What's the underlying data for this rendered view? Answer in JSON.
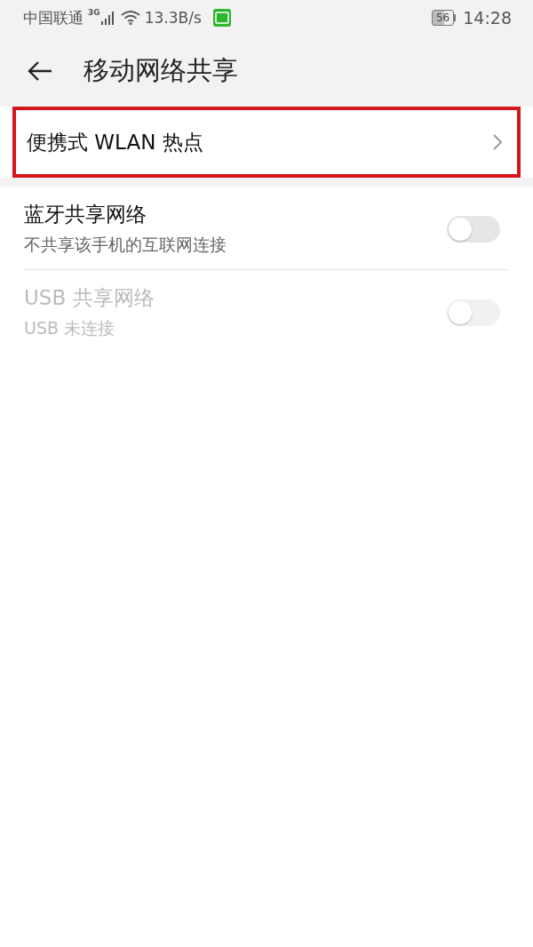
{
  "status_bar": {
    "carrier": "中国联通",
    "network_type": "3G",
    "speed": "13.3B/s",
    "battery": "56",
    "time": "14:28"
  },
  "header": {
    "title": "移动网络共享"
  },
  "link_item": {
    "label": "便携式 WLAN 热点",
    "highlighted": true
  },
  "toggle_items": [
    {
      "title": "蓝牙共享网络",
      "subtitle": "不共享该手机的互联网连接",
      "on": false,
      "disabled": false
    },
    {
      "title": "USB 共享网络",
      "subtitle": "USB 未连接",
      "on": false,
      "disabled": true
    }
  ]
}
